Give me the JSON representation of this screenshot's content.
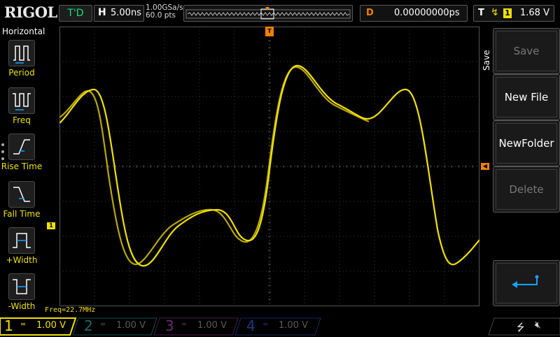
{
  "brand": "RIGOL",
  "status": "T'D",
  "horizontal": {
    "tag": "H",
    "timebase": "5.00ns",
    "sample_rate": "1.00GSa/s",
    "points": "60.0 pts"
  },
  "delay": {
    "tag": "D",
    "value": "0.00000000ps"
  },
  "trigger": {
    "tag": "T",
    "edge": "rising-edge-icon",
    "source": "1",
    "level": "1.68 V"
  },
  "left_menu": {
    "title": "Horizontal",
    "items": [
      {
        "label": "Period",
        "icon": "period-icon"
      },
      {
        "label": "Freq",
        "icon": "freq-icon"
      },
      {
        "label": "Rise Time",
        "icon": "rise-time-icon"
      },
      {
        "label": "Fall Time",
        "icon": "fall-time-icon"
      },
      {
        "label": "+Width",
        "icon": "positive-width-icon"
      },
      {
        "label": "-Width",
        "icon": "negative-width-icon"
      }
    ]
  },
  "right_menu": {
    "title": "Save",
    "items": [
      {
        "label": "Save",
        "enabled": false
      },
      {
        "label": "New File",
        "enabled": true
      },
      {
        "label": "NewFolder",
        "enabled": true
      },
      {
        "label": "Delete",
        "enabled": false
      },
      {
        "label": "",
        "icon": "return-icon",
        "enabled": true
      }
    ]
  },
  "measurement": "Freq=22.7MHz",
  "channels": [
    {
      "num": "1",
      "coupling": "DC",
      "scale": "1.00 V",
      "color": "#f0e000",
      "active": true
    },
    {
      "num": "2",
      "coupling": "DC",
      "scale": "1.00 V",
      "color": "#00c8c8",
      "active": false
    },
    {
      "num": "3",
      "coupling": "DC",
      "scale": "1.00 V",
      "color": "#d040d0",
      "active": false
    },
    {
      "num": "4",
      "coupling": "DC",
      "scale": "1.00 V",
      "color": "#2070f0",
      "active": false
    }
  ],
  "colors": {
    "trace": "#f0e000",
    "trigger_marker": "#f08000",
    "grid": "#3a3a3a"
  }
}
